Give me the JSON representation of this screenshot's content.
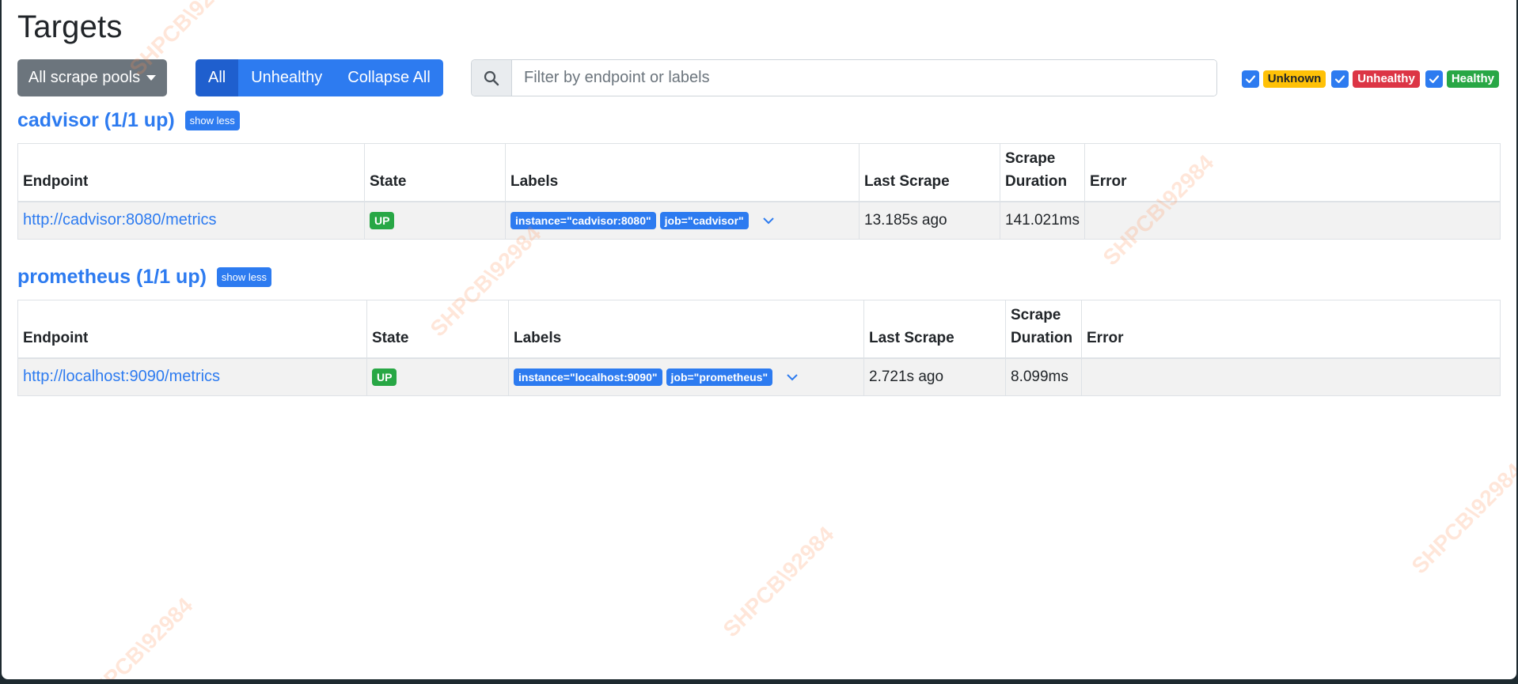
{
  "page": {
    "title": "Targets"
  },
  "toolbar": {
    "pools_label": "All scrape pools",
    "filter_all": "All",
    "filter_unhealthy": "Unhealthy",
    "collapse_all": "Collapse All",
    "search_placeholder": "Filter by endpoint or labels",
    "health_filters": [
      {
        "label": "Unknown",
        "checked": true,
        "color": "#ffc107"
      },
      {
        "label": "Unhealthy",
        "checked": true,
        "color": "#dc3545"
      },
      {
        "label": "Healthy",
        "checked": true,
        "color": "#28a745"
      }
    ]
  },
  "columns": {
    "endpoint": "Endpoint",
    "state": "State",
    "labels": "Labels",
    "last_scrape": "Last Scrape",
    "scrape_duration_1": "Scrape",
    "scrape_duration_2": "Duration",
    "error": "Error"
  },
  "pools": [
    {
      "title": "cadvisor (1/1 up)",
      "toggle": "show less",
      "rows": [
        {
          "endpoint": "http://cadvisor:8080/metrics",
          "state": "UP",
          "labels": [
            "instance=\"cadvisor:8080\"",
            "job=\"cadvisor\""
          ],
          "last_scrape": "13.185s ago",
          "duration": "141.021ms",
          "error": ""
        }
      ]
    },
    {
      "title": "prometheus (1/1 up)",
      "toggle": "show less",
      "rows": [
        {
          "endpoint": "http://localhost:9090/metrics",
          "state": "UP",
          "labels": [
            "instance=\"localhost:9090\"",
            "job=\"prometheus\""
          ],
          "last_scrape": "2.721s ago",
          "duration": "8.099ms",
          "error": ""
        }
      ]
    }
  ],
  "watermark": "SHPCB\\92984",
  "colors": {
    "primary": "#2d7bf0",
    "secondary": "#6c757d",
    "success": "#28a745"
  }
}
